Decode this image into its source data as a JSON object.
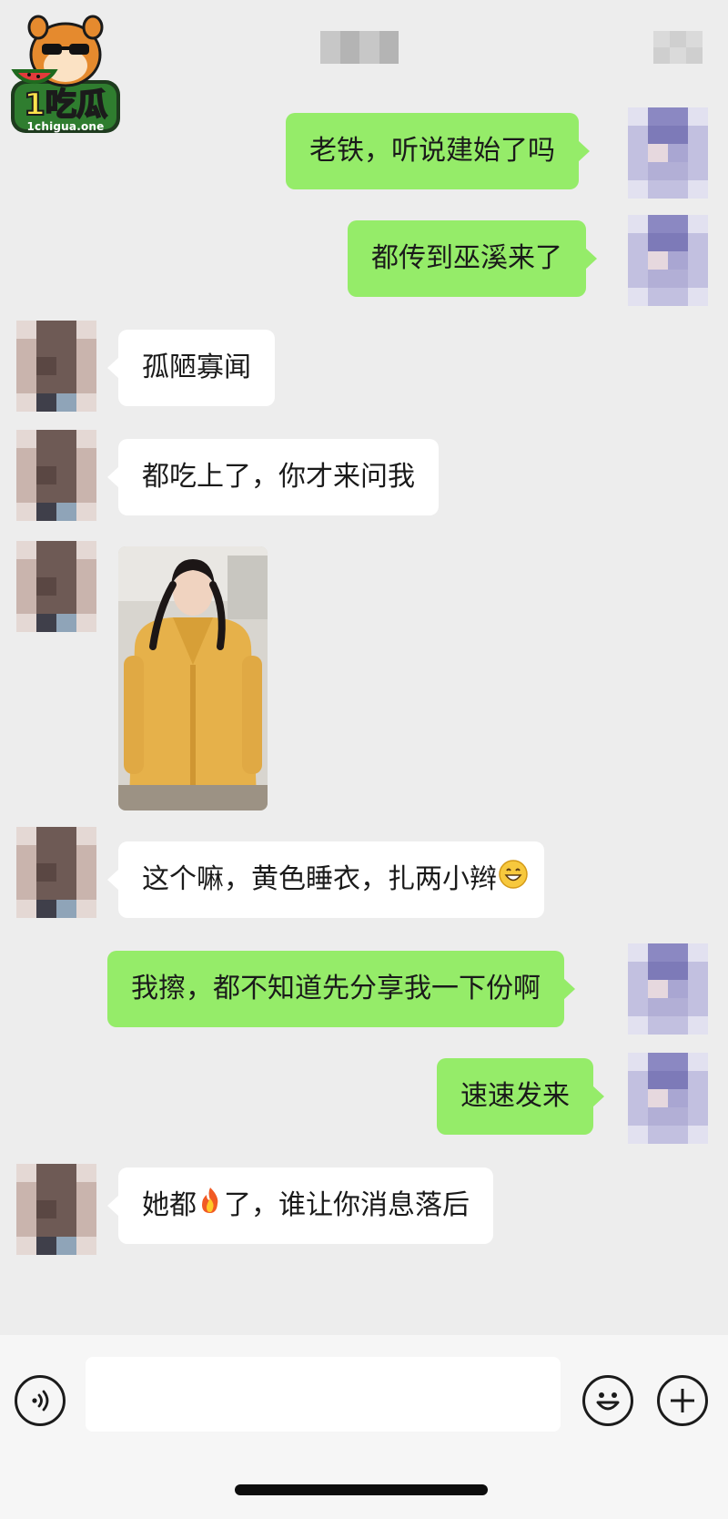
{
  "watermark": {
    "logo_text": "1chigua.one",
    "logo_icon": "hamster-mascot-icon"
  },
  "header": {
    "title": "",
    "more_icon": "more-icon"
  },
  "messages": [
    {
      "side": "right",
      "text": "老铁，听说建始了吗"
    },
    {
      "side": "right",
      "text": "都传到巫溪来了"
    },
    {
      "side": "left",
      "text": "孤陋寡闻"
    },
    {
      "side": "left",
      "text": "都吃上了，你才来问我"
    },
    {
      "side": "left",
      "type": "image",
      "description": "photo-thumbnail"
    },
    {
      "side": "left",
      "text": "这个嘛，黄色睡衣，扎两小辫",
      "emoji": "grin-emoji"
    },
    {
      "side": "right",
      "text": "我擦，都不知道先分享我一下份啊"
    },
    {
      "side": "right",
      "text": "速速发来"
    },
    {
      "side": "left",
      "text_before": "她都",
      "emoji": "fire-emoji",
      "text_after": "了，谁让你消息落后"
    }
  ],
  "input_bar": {
    "voice_icon": "voice-icon",
    "input_value": "",
    "emoji_icon": "emoji-icon",
    "add_icon": "plus-icon"
  },
  "colors": {
    "background": "#ededed",
    "bubble_self": "#95ec69",
    "bubble_other": "#ffffff",
    "input_bar": "#f6f6f6"
  }
}
